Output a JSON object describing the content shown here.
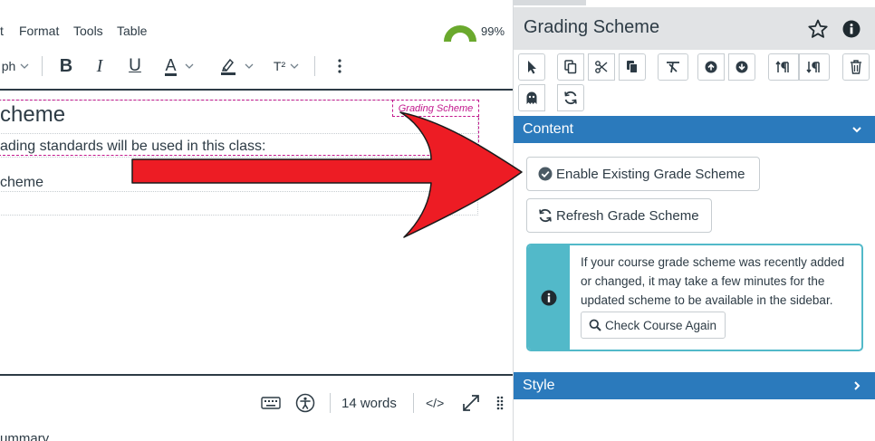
{
  "menubar": {
    "edit_fragment": "t",
    "format": "Format",
    "tools": "Tools",
    "table": "Table"
  },
  "editor_status": {
    "score_percent": "99%",
    "score_value": 0.99,
    "score_color": "#6aa92d"
  },
  "toolbar": {
    "block_format_fragment": "ph",
    "bold": "B",
    "italic": "I",
    "underline": "U",
    "text_color": "A",
    "superscript": "T²",
    "icons": [
      "chevron-down-icon",
      "bold-icon",
      "italic-icon",
      "underline-icon",
      "text-color-icon",
      "highlight-icon",
      "superscript-icon",
      "more-icon"
    ]
  },
  "document": {
    "heading_fragment": "cheme",
    "tag_label": "Grading Scheme",
    "line1_fragment": "ading standards will be used in this class:",
    "line2_fragment": "cheme",
    "tag_color": "#c2188d"
  },
  "statusbar": {
    "word_count": "14 words",
    "html_toggle": "</>",
    "icons": [
      "keyboard-icon",
      "accessibility-icon",
      "fullscreen-icon",
      "drag-handle-icon"
    ]
  },
  "below_editor": {
    "summary_fragment": "ummary"
  },
  "sidebar": {
    "title": "Grading Scheme",
    "favorite_icon": "star-icon",
    "info_icon": "info-icon",
    "toolbar_icons": [
      "pointer-icon",
      "copy-icon",
      "cut-icon",
      "paste-icon",
      "clear-format-icon",
      "move-up-icon",
      "move-down-icon",
      "insert-before-icon",
      "insert-after-icon",
      "delete-icon",
      "ghost-icon",
      "refresh-icon"
    ],
    "content_section": {
      "label": "Content",
      "expanded": true
    },
    "enable_button": "Enable Existing Grade Scheme",
    "refresh_button": "Refresh Grade Scheme",
    "notice": {
      "text": "If your course grade scheme was recently added or changed, it may take a few minutes for the updated scheme to be available in the sidebar.",
      "button": "Check Course Again"
    },
    "style_section": {
      "label": "Style",
      "expanded": false
    }
  },
  "colors": {
    "section_blue": "#2b7abc",
    "info_teal": "#52b9c9",
    "arrow_red": "#ed1c24",
    "header_gray": "#e1e3e5"
  }
}
